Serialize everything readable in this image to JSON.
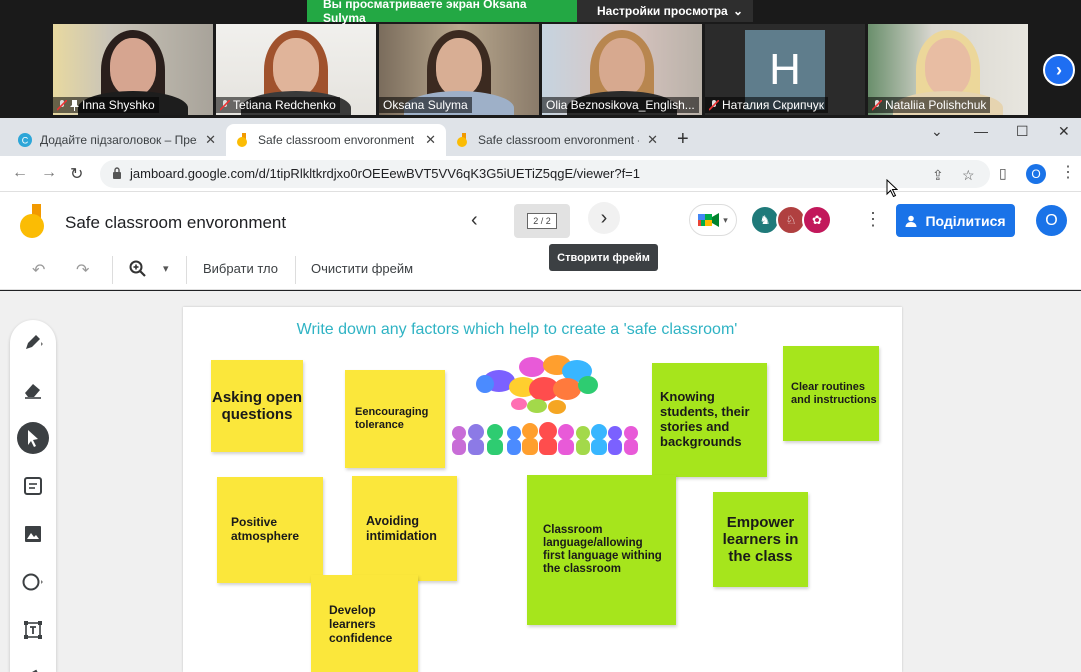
{
  "zoom": {
    "share_banner": "Вы просматриваете экран Oksana Sulyma",
    "view_settings": "Настройки просмотра",
    "view_settings_chevron": "⌄",
    "next_page": "›",
    "participants": [
      {
        "name": "Inna Shyshko"
      },
      {
        "name": "Tetiana Redchenko"
      },
      {
        "name": "Oksana Sulyma"
      },
      {
        "name": "Olia Beznosikova_English..."
      },
      {
        "name": "Наталия Скрипчук",
        "avatar_letter": "H"
      },
      {
        "name": "Nataliia Polishchuk"
      }
    ]
  },
  "browser": {
    "tabs": [
      {
        "title": "Додайте підзаголовок – Презен"
      },
      {
        "title": "Safe classroom envoronment - G"
      },
      {
        "title": "Safe classroom envoronment - G"
      }
    ],
    "new_tab": "+",
    "url": "jamboard.google.com/d/1tipRlkltkrdjxo0rOEEewBVT5VV6qK3G5iUETiZ5qgE/viewer?f=1",
    "profile_letter": "O"
  },
  "jamboard": {
    "title": "Safe classroom envoronment",
    "frame_indicator": "2 / 2",
    "share_label": "Поділитися",
    "user_letter": "O",
    "tooltip": "Створити фрейм",
    "set_background": "Вибрати тло",
    "clear_frame": "Очистити фрейм"
  },
  "board": {
    "title": "Write down any factors which help to create a 'safe classroom'",
    "notes": [
      {
        "text": "Asking open questions",
        "color": "yellow"
      },
      {
        "text": "Eencouraging tolerance",
        "color": "yellow"
      },
      {
        "text": "Knowing students, their stories and backgrounds",
        "color": "green"
      },
      {
        "text": "Clear routines and instructions",
        "color": "green"
      },
      {
        "text": "Positive atmosphere",
        "color": "yellow"
      },
      {
        "text": "Avoiding intimidation",
        "color": "yellow"
      },
      {
        "text": "Classroom language/allowing first language withing the classroom",
        "color": "green"
      },
      {
        "text": "Empower learners in the class",
        "color": "green"
      },
      {
        "text": "Develop learners confidence",
        "color": "yellow"
      }
    ]
  },
  "colors": {
    "accent_blue": "#1a73e8",
    "note_yellow": "#fbe73b",
    "note_green": "#a6e51c",
    "title_teal": "#2fb3c4",
    "zoom_green": "#23a844"
  }
}
